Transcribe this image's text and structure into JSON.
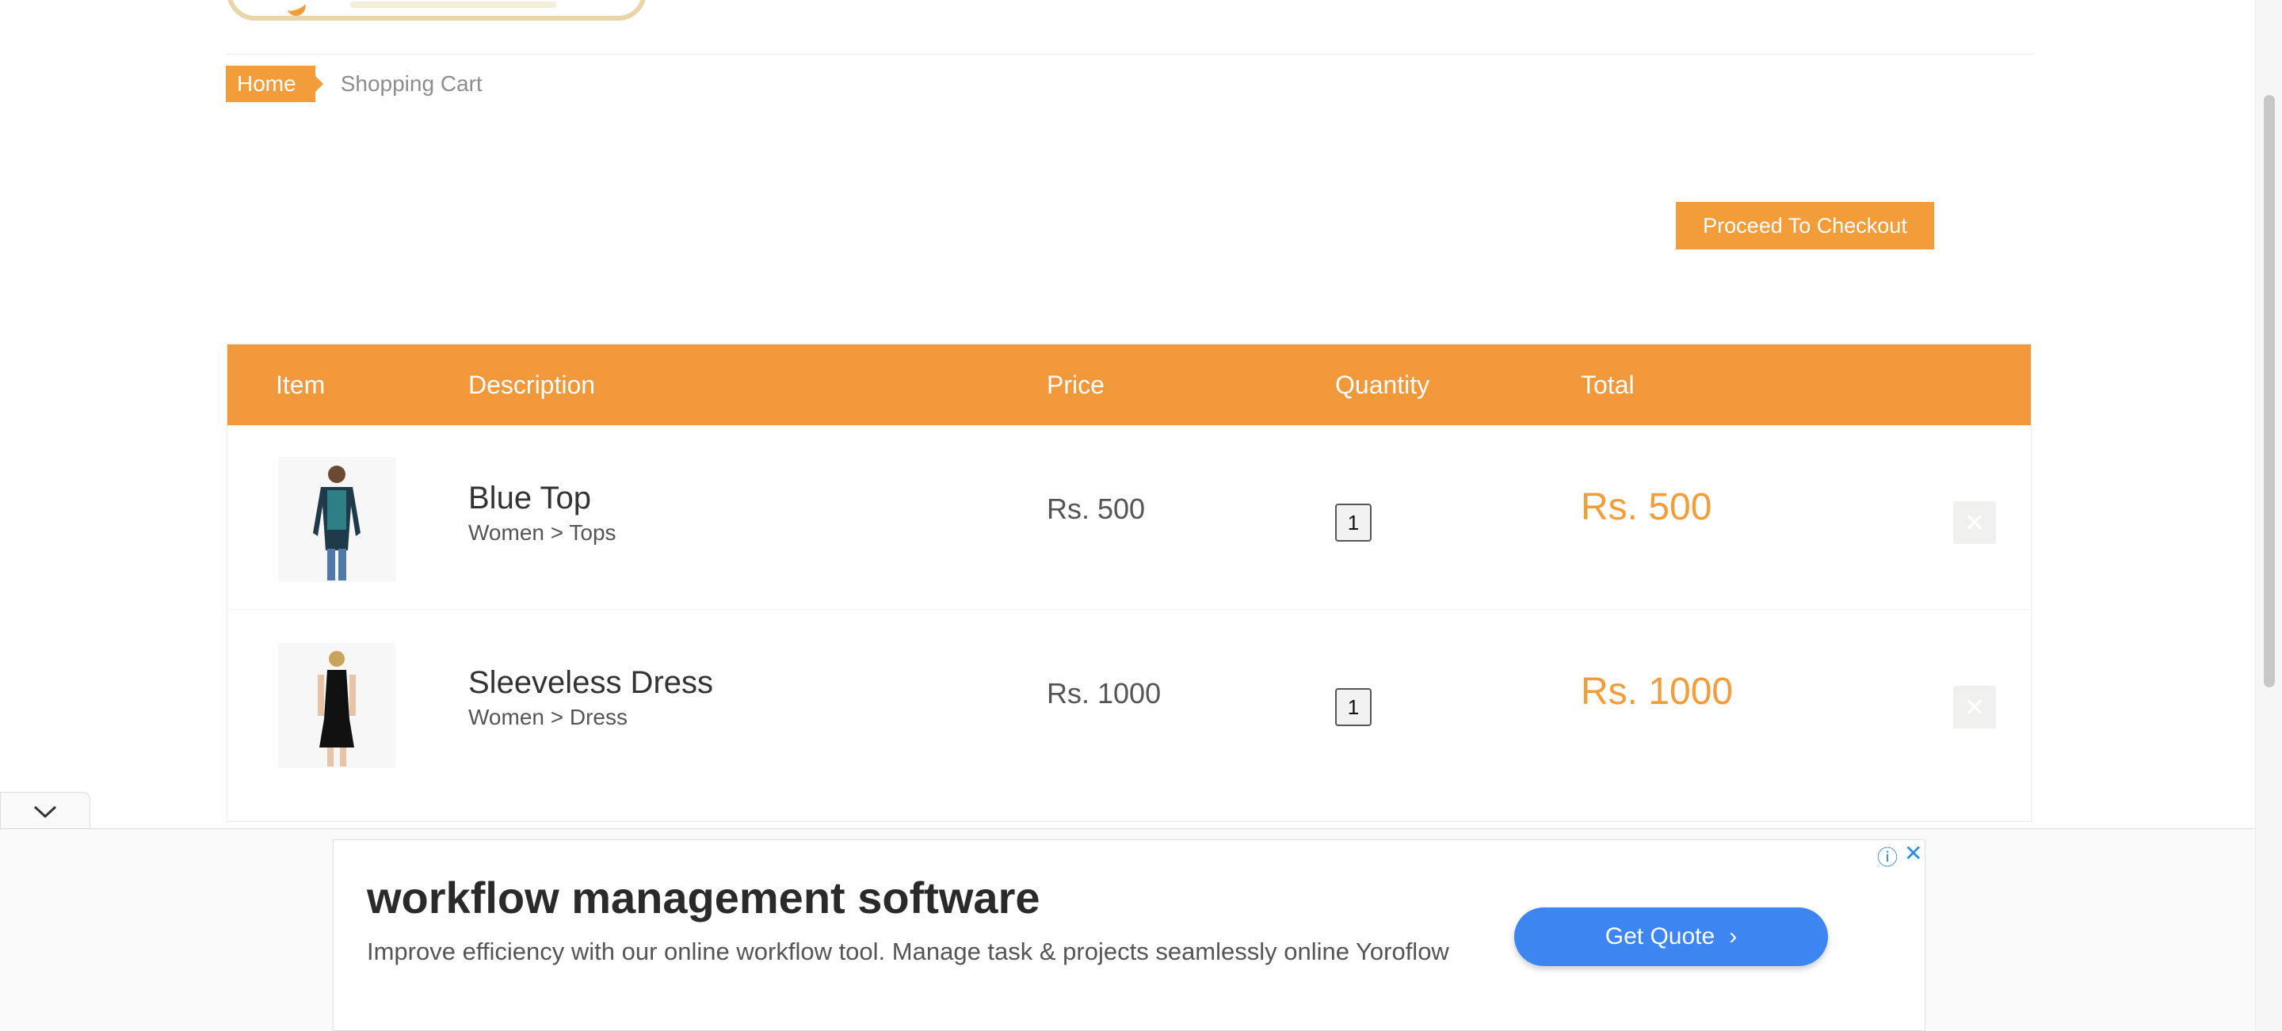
{
  "breadcrumb": {
    "home": "Home",
    "current": "Shopping Cart"
  },
  "checkout": {
    "label": "Proceed To Checkout"
  },
  "cart": {
    "headers": {
      "item": "Item",
      "description": "Description",
      "price": "Price",
      "quantity": "Quantity",
      "total": "Total"
    },
    "rows": [
      {
        "name": "Blue Top",
        "category": "Women > Tops",
        "price": "Rs. 500",
        "quantity": "1",
        "total": "Rs. 500",
        "delete_icon": "close-icon"
      },
      {
        "name": "Sleeveless Dress",
        "category": "Women > Dress",
        "price": "Rs. 1000",
        "quantity": "1",
        "total": "Rs. 1000",
        "delete_icon": "close-icon"
      }
    ]
  },
  "ad": {
    "title": "workflow management software",
    "text": "Improve efficiency with our online workflow tool. Manage task & projects seamlessly online Yoroflow",
    "cta": "Get Quote",
    "info_icon": "info-icon",
    "close_icon": "close-icon"
  },
  "colors": {
    "accent": "#f39c3a",
    "ad_cta": "#3d85f0",
    "ad_icons": "#2b8be6"
  }
}
